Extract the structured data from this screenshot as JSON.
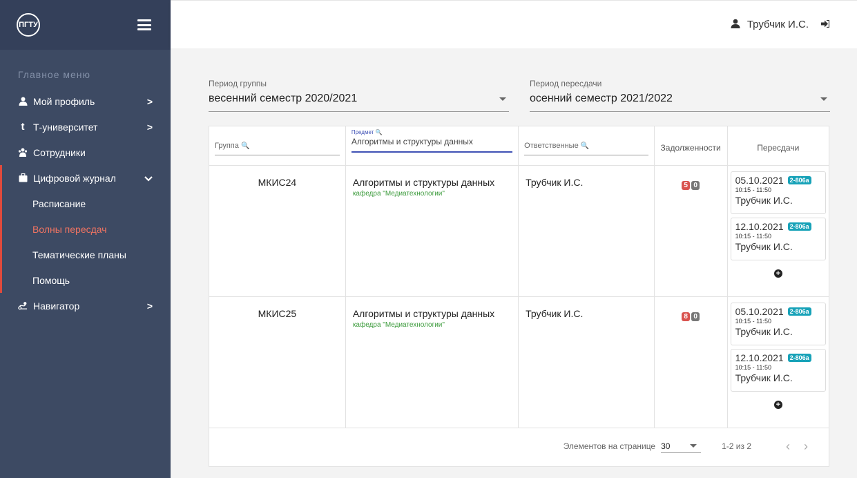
{
  "sidebar": {
    "logo_text": "ПГТУ",
    "menu_title": "Главное меню",
    "items": [
      {
        "label": "Мой профиль"
      },
      {
        "label": "Т-университет"
      },
      {
        "label": "Сотрудники"
      },
      {
        "label": "Цифровой журнал"
      },
      {
        "label": "Навигатор"
      }
    ],
    "sub_items": [
      {
        "label": "Расписание"
      },
      {
        "label": "Волны пересдач"
      },
      {
        "label": "Тематические планы"
      },
      {
        "label": "Помощь"
      }
    ],
    "active_color": "#e04a3c"
  },
  "header": {
    "user_name": "Трубчик И.С."
  },
  "filters": {
    "group_period_label": "Период группы",
    "group_period_value": "весенний семестр 2020/2021",
    "retake_period_label": "Период пересдачи",
    "retake_period_value": "осенний семестр 2021/2022"
  },
  "table": {
    "headers": {
      "group": "Группа",
      "subject_mini": "Предмет",
      "subject_value": "Алгоритмы и структуры данных",
      "responsible": "Ответственные",
      "debts": "Задолженности",
      "retakes": "Пересдачи"
    },
    "rows": [
      {
        "group": "МКИС24",
        "subject": "Алгоритмы и структуры данных",
        "department": "кафедра \"Медиатехнологии\"",
        "responsible": "Трубчик И.С.",
        "debt_red": "5",
        "debt_grey": "0",
        "retakes": [
          {
            "date": "05.10.2021",
            "room": "2-806a",
            "time": "10:15 - 11:50",
            "teacher": "Трубчик И.С."
          },
          {
            "date": "12.10.2021",
            "room": "2-806a",
            "time": "10:15 - 11:50",
            "teacher": "Трубчик И.С."
          }
        ]
      },
      {
        "group": "МКИС25",
        "subject": "Алгоритмы и структуры данных",
        "department": "кафедра \"Медиатехнологии\"",
        "responsible": "Трубчик И.С.",
        "debt_red": "8",
        "debt_grey": "0",
        "retakes": [
          {
            "date": "05.10.2021",
            "room": "2-806a",
            "time": "10:15 - 11:50",
            "teacher": "Трубчик И.С."
          },
          {
            "date": "12.10.2021",
            "room": "2-806a",
            "time": "10:15 - 11:50",
            "teacher": "Трубчик И.С."
          }
        ]
      }
    ]
  },
  "paginator": {
    "label": "Элементов на странице",
    "page_size": "30",
    "range": "1-2 из 2"
  }
}
